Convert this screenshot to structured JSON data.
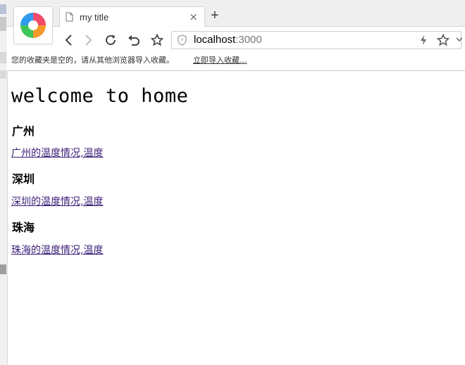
{
  "browser": {
    "tab_title": "my title",
    "tab_close": "×",
    "new_tab": "+",
    "url_host": "localhost",
    "url_port": ":3000"
  },
  "bookmarks_bar": {
    "message": "您的收藏夹是空的，请从其他浏览器导入收藏。",
    "import_link": "立即导入收藏..."
  },
  "page": {
    "heading": "welcome to home",
    "cities": [
      {
        "name": "广州",
        "link": "广州的温度情况,温度"
      },
      {
        "name": "深圳",
        "link": "深圳的温度情况,温度"
      },
      {
        "name": "珠海",
        "link": "珠海的温度情况,温度"
      }
    ]
  },
  "icons": {
    "logo": "browser-logo-icon",
    "tab": "page-icon",
    "back": "back-arrow-icon",
    "forward": "forward-arrow-icon",
    "reload": "reload-icon",
    "undo": "undo-icon",
    "favorite": "star-icon",
    "security": "shield-icon",
    "speed": "lightning-icon"
  }
}
